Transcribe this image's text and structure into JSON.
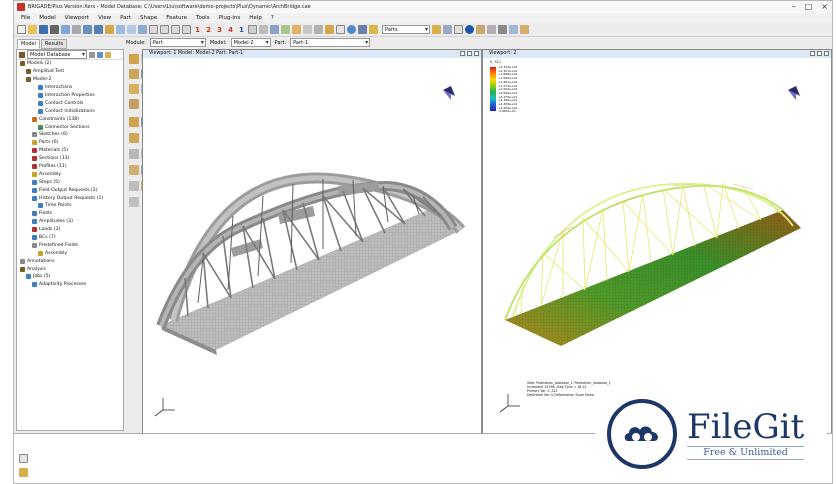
{
  "window": {
    "title": "BRIGADE/Plus Version:Xerx - Model Database: C:\\Users\\Ltu\\software\\demo-projects\\Plus\\Dynamic\\ArchBridge.cae"
  },
  "menu": [
    "File",
    "Model",
    "Viewport",
    "View",
    "Part",
    "Shape",
    "Feature",
    "Tools",
    "Plug-ins",
    "Help",
    "?"
  ],
  "toolbar": {
    "numbers": [
      "1",
      "2",
      "3",
      "4",
      "1"
    ],
    "parts_combo": "Parts"
  },
  "context": {
    "module_label": "Module:",
    "module_value": "Part",
    "model_label": "Model:",
    "model_value": "Model-2",
    "part_label": "Part:",
    "part_value": "Part-1"
  },
  "tabs": [
    "Model",
    "Results"
  ],
  "tree": {
    "header": "Model Database",
    "items": [
      {
        "label": "Models (2)",
        "indent": 0,
        "color": "#7a5a2a"
      },
      {
        "label": "Amplitud Test",
        "indent": 1,
        "color": "#7a5a2a"
      },
      {
        "label": "Model-2",
        "indent": 1,
        "color": "#7a5a2a"
      },
      {
        "label": "Interactions",
        "indent": 3,
        "color": "#3f7fbf"
      },
      {
        "label": "Interaction Properties",
        "indent": 3,
        "color": "#3f7fbf"
      },
      {
        "label": "Contact Controls",
        "indent": 3,
        "color": "#3f7fbf"
      },
      {
        "label": "Contact Initializations",
        "indent": 3,
        "color": "#3f7fbf"
      },
      {
        "label": "Constraints (138)",
        "indent": 2,
        "color": "#c76b1a"
      },
      {
        "label": "Connector Sections",
        "indent": 3,
        "color": "#4c8c4c"
      },
      {
        "label": "Sketches (6)",
        "indent": 2,
        "color": "#888888"
      },
      {
        "label": "Parts (6)",
        "indent": 2,
        "color": "#c9a227"
      },
      {
        "label": "Materials (5)",
        "indent": 2,
        "color": "#b03030"
      },
      {
        "label": "Sections (13)",
        "indent": 2,
        "color": "#b03030"
      },
      {
        "label": "Profiles (11)",
        "indent": 2,
        "color": "#b03030"
      },
      {
        "label": "Assembly",
        "indent": 2,
        "color": "#c9a227"
      },
      {
        "label": "Steps (5)",
        "indent": 2,
        "color": "#3f7fbf"
      },
      {
        "label": "Field Output Requests (2)",
        "indent": 2,
        "color": "#3f7fbf"
      },
      {
        "label": "History Output Requests (1)",
        "indent": 2,
        "color": "#3f7fbf"
      },
      {
        "label": "Time Points",
        "indent": 3,
        "color": "#3f7fbf"
      },
      {
        "label": "Fields",
        "indent": 2,
        "color": "#3f7fbf"
      },
      {
        "label": "Amplitudes (3)",
        "indent": 2,
        "color": "#3f7fbf"
      },
      {
        "label": "Loads (3)",
        "indent": 2,
        "color": "#b03030"
      },
      {
        "label": "BCs (7)",
        "indent": 2,
        "color": "#3f7fbf"
      },
      {
        "label": "Predefined Fields",
        "indent": 2,
        "color": "#888888"
      },
      {
        "label": "Assembly",
        "indent": 3,
        "color": "#c9a227"
      },
      {
        "label": "Annotations",
        "indent": 0,
        "color": "#888888"
      },
      {
        "label": "Analysis",
        "indent": 0,
        "color": "#7a5a2a"
      },
      {
        "label": "Jobs (5)",
        "indent": 1,
        "color": "#3f7fbf"
      },
      {
        "label": "Adaptivity Processes",
        "indent": 2,
        "color": "#3f7fbf"
      }
    ]
  },
  "viewport1": {
    "title": "Viewport: 1   Model: Model-2   Part: Part-1"
  },
  "viewport2": {
    "title": "Viewport: 2",
    "legend_title": "S, S11",
    "legend_values": [
      "+2.315e+02",
      "+2.107e+02",
      "+1.898e+02",
      "+1.690e+02",
      "+1.481e+02",
      "+1.273e+02",
      "+1.064e+02",
      "+8.560e+01",
      "+6.475e+01",
      "+4.390e+01",
      "+2.305e+01",
      "+2.200e+00",
      "-1.865e+01"
    ],
    "info": [
      "Step: Pedestrian_loadcase_1, Pedestrian_loadcase_1",
      "Increment 10798: Step Time = 18.12",
      "Primary Var: S, S11",
      "Deformed Var: U  Deformation Scale Factor"
    ]
  },
  "colors": {
    "viewport_title_bg": "#dbe7f5",
    "bridge_grey": "#9a9a9a",
    "accent_brand": "#1d3767"
  },
  "watermark": {
    "name": "FileGit",
    "tagline": "Free & Unlimited"
  }
}
